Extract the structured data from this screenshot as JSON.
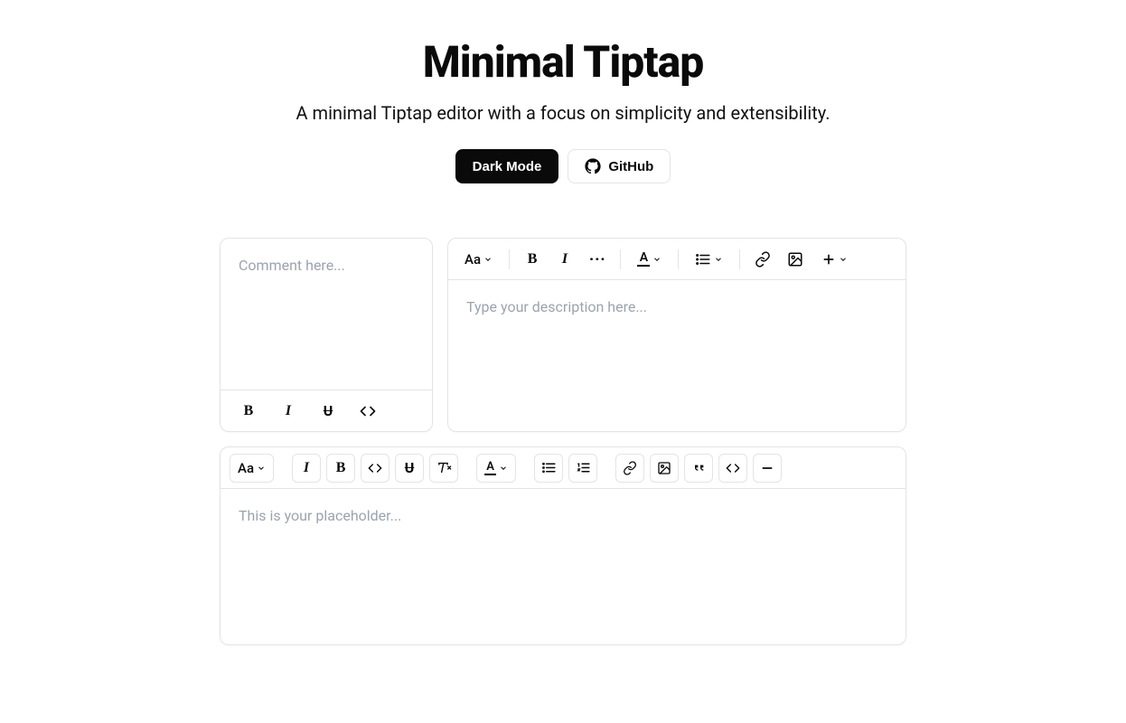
{
  "hero": {
    "title": "Minimal Tiptap",
    "subtitle": "A minimal Tiptap editor with a focus on simplicity and extensibility.",
    "dark_mode_label": "Dark Mode",
    "github_label": "GitHub"
  },
  "editor1": {
    "placeholder": "Comment here...",
    "toolbar": {
      "bold": "B",
      "italic": "I",
      "strike": "U",
      "code": "</>"
    }
  },
  "editor2": {
    "placeholder": "Type your description here...",
    "toolbar": {
      "paragraph": "Aa",
      "bold": "B",
      "italic": "I",
      "more": "···",
      "color": "A",
      "list": "≡",
      "link": "link",
      "image": "image",
      "plus": "+"
    }
  },
  "editor3": {
    "placeholder": "This is your placeholder...",
    "toolbar": {
      "paragraph": "Aa",
      "italic": "I",
      "bold": "B",
      "code": "</>",
      "strike": "U",
      "clear": "T",
      "color": "A",
      "ul": "ul",
      "ol": "ol",
      "link": "link",
      "image": "image",
      "quote": "quote",
      "codeblock": "</>",
      "hr": "—"
    }
  }
}
